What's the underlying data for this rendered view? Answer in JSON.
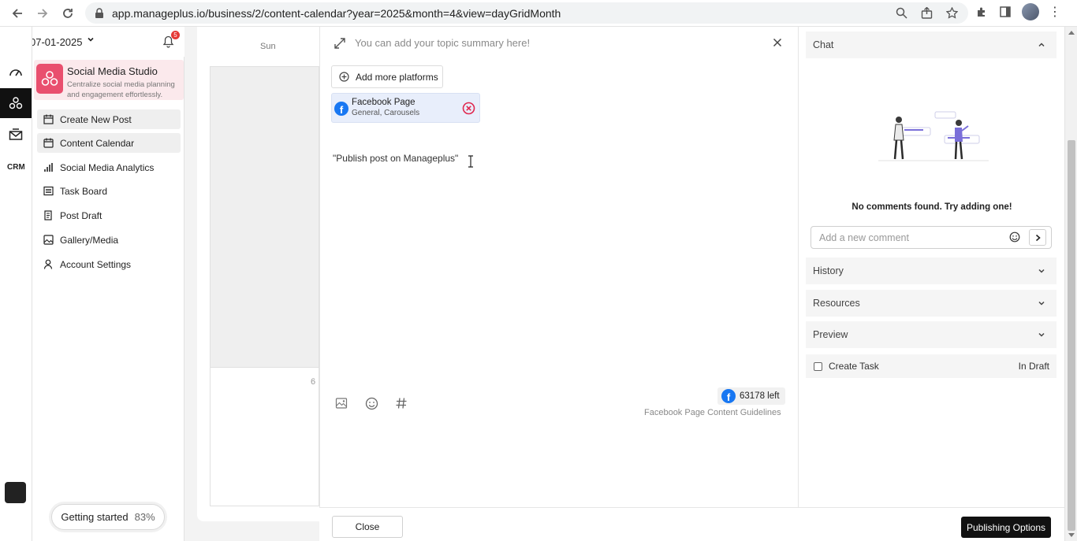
{
  "browser": {
    "url": "app.manageplus.io/business/2/content-calendar?year=2025&month=4&view=dayGridMonth"
  },
  "header": {
    "date": "07-01-2025",
    "notification_count": "5"
  },
  "studio": {
    "title": "Social Media Studio",
    "description": "Centralize social media planning and engagement effortlessly."
  },
  "menu": {
    "items": [
      {
        "label": "Create New Post"
      },
      {
        "label": "Content Calendar"
      },
      {
        "label": "Social Media Analytics"
      },
      {
        "label": "Task Board"
      },
      {
        "label": "Post Draft"
      },
      {
        "label": "Gallery/Media"
      },
      {
        "label": "Account Settings"
      }
    ]
  },
  "getting_started": {
    "label": "Getting started",
    "percent": "83%"
  },
  "calendar": {
    "day_header": "Sun",
    "day_number": "6"
  },
  "editor": {
    "topic_placeholder": "You can add your topic summary here!",
    "add_platforms_label": "Add more platforms",
    "platform": {
      "name": "Facebook Page",
      "types": "General, Carousels"
    },
    "post_text": "\"Publish post on Manageplus\"",
    "chars_left": "63178 left",
    "guidelines_link": "Facebook Page Content Guidelines"
  },
  "actions": {
    "close_label": "Close",
    "publish_label": "Publishing Options"
  },
  "right_panel": {
    "chat_title": "Chat",
    "no_comments": "No comments found. Try adding one!",
    "comment_placeholder": "Add a new comment",
    "history_title": "History",
    "resources_title": "Resources",
    "preview_title": "Preview",
    "create_task_label": "Create Task",
    "task_status": "In Draft"
  },
  "colors": {
    "accent": "#e94f6e",
    "facebook": "#1877f2",
    "remove": "#e0284f",
    "primary_button": "#111111"
  }
}
